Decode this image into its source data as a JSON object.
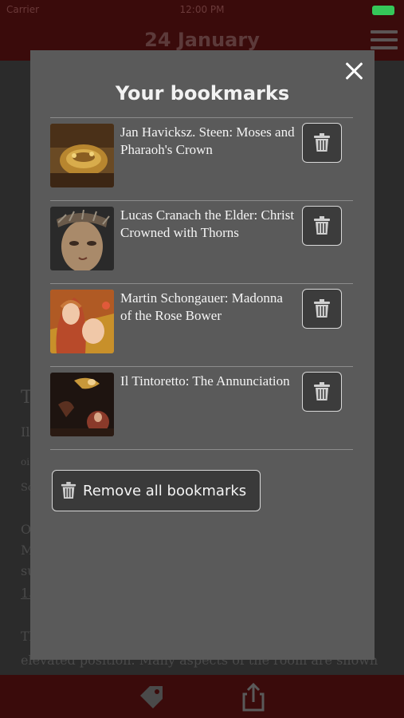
{
  "status_bar": {
    "carrier": "Carrier",
    "time": "12:00 PM"
  },
  "nav": {
    "title": "24 January"
  },
  "background_text": [
    "Th",
    "Il",
    "oi",
    "So",
    "O",
    "M",
    "su",
    "15",
    "Th",
    "elevated position. Many aspects of the room are shown"
  ],
  "modal": {
    "title": "Your bookmarks",
    "bookmarks": [
      {
        "title": "Jan Havicksz. Steen: Moses and Pharaoh's Crown"
      },
      {
        "title": "Lucas Cranach the Elder: Christ Crowned with Thorns"
      },
      {
        "title": "Martin Schongauer: Madonna of the Rose Bower"
      },
      {
        "title": "Il Tintoretto: The Annunciation"
      }
    ],
    "remove_all_label": "Remove all bookmarks"
  },
  "icons": {
    "close": "close-icon",
    "delete": "trash-icon",
    "menu": "hamburger-menu-icon",
    "tag": "tag-icon",
    "share": "share-icon"
  },
  "colors": {
    "header_background": "#3a0b0b",
    "modal_background": "#5a5a5a",
    "text": "#f4f4f4",
    "battery": "#35c759"
  }
}
